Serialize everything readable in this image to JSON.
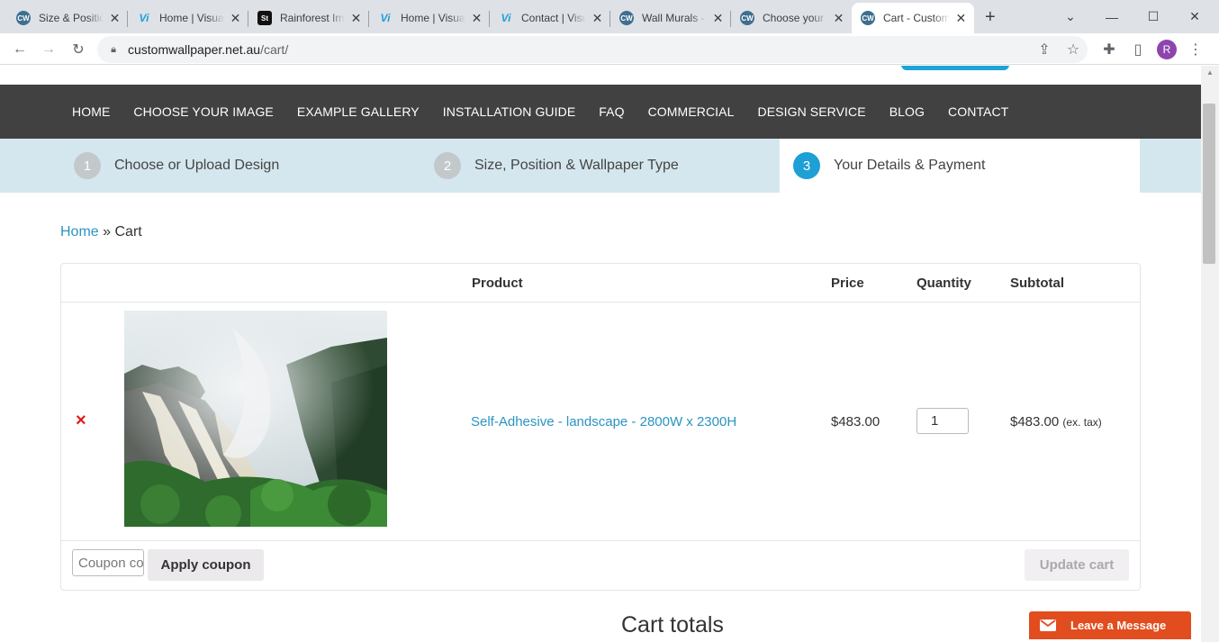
{
  "browser": {
    "tabs": [
      {
        "favicon": "CW",
        "title": "Size & Position",
        "active": false
      },
      {
        "favicon": "Vi",
        "title": "Home | Visual",
        "active": false
      },
      {
        "favicon": "St",
        "title": "Rainforest Im",
        "active": false
      },
      {
        "favicon": "Vi",
        "title": "Home | Visual",
        "active": false
      },
      {
        "favicon": "Vi",
        "title": "Contact | Visu",
        "active": false
      },
      {
        "favicon": "CW",
        "title": "Wall Murals -",
        "active": false
      },
      {
        "favicon": "CW",
        "title": "Choose your",
        "active": false
      },
      {
        "favicon": "CW",
        "title": "Cart - Custom",
        "active": true
      }
    ],
    "new_tab": "+",
    "address": {
      "domain": "customwallpaper.net.au",
      "path": "/cart/"
    },
    "profile_initial": "R"
  },
  "nav": {
    "items": [
      "HOME",
      "CHOOSE YOUR IMAGE",
      "EXAMPLE GALLERY",
      "INSTALLATION GUIDE",
      "FAQ",
      "COMMERCIAL",
      "DESIGN SERVICE",
      "BLOG",
      "CONTACT"
    ]
  },
  "steps": [
    {
      "num": "1",
      "label": "Choose or Upload Design",
      "active": false
    },
    {
      "num": "2",
      "label": "Size, Position & Wallpaper Type",
      "active": false
    },
    {
      "num": "3",
      "label": "Your Details & Payment",
      "active": true
    }
  ],
  "breadcrumb": {
    "home": "Home",
    "sep": "»",
    "current": "Cart"
  },
  "cart": {
    "headers": {
      "product": "Product",
      "price": "Price",
      "quantity": "Quantity",
      "subtotal": "Subtotal"
    },
    "item": {
      "remove": "×",
      "product": "Self-Adhesive - landscape - 2800W x 2300H",
      "price": "$483.00",
      "quantity": "1",
      "subtotal": "$483.00",
      "tax_note": "(ex. tax)"
    },
    "coupon_placeholder": "Coupon code",
    "apply_label": "Apply coupon",
    "update_label": "Update cart"
  },
  "totals_heading": "Cart totals",
  "chat": {
    "label": "Leave a Message",
    "color": "#e14d1e"
  }
}
